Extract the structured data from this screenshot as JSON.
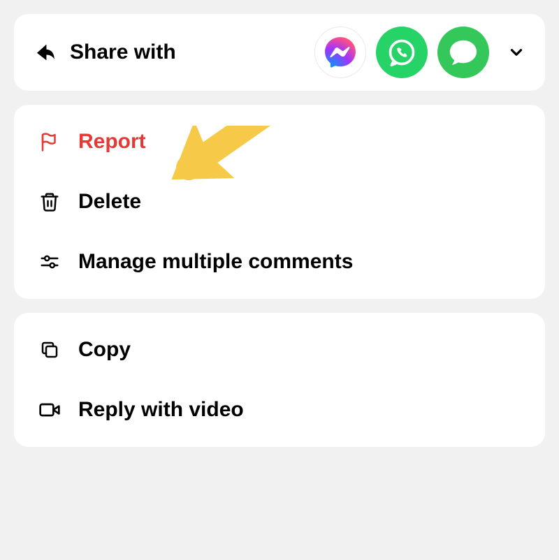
{
  "share": {
    "label": "Share with"
  },
  "menu": {
    "group1": {
      "report": "Report",
      "delete": "Delete",
      "manage": "Manage multiple comments"
    },
    "group2": {
      "copy": "Copy",
      "reply_video": "Reply with video"
    }
  },
  "annotation": {
    "arrow_color": "#F7C948"
  }
}
